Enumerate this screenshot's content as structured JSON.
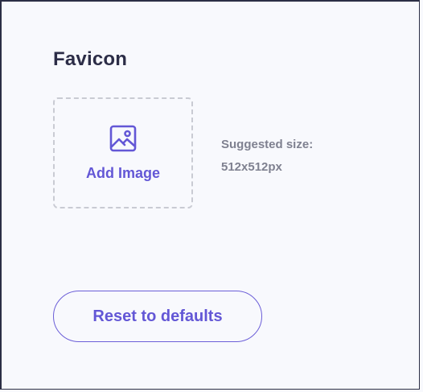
{
  "favicon": {
    "title": "Favicon",
    "upload": {
      "label": "Add Image",
      "icon": "image-icon"
    },
    "hint": {
      "line1": "Suggested size:",
      "line2": "512x512px"
    }
  },
  "actions": {
    "reset_label": "Reset to defaults"
  },
  "colors": {
    "accent": "#6357d6",
    "title": "#2c2d47",
    "muted": "#7f8190",
    "dashed_border": "#c9cbd3",
    "background": "#f8f9fd"
  }
}
